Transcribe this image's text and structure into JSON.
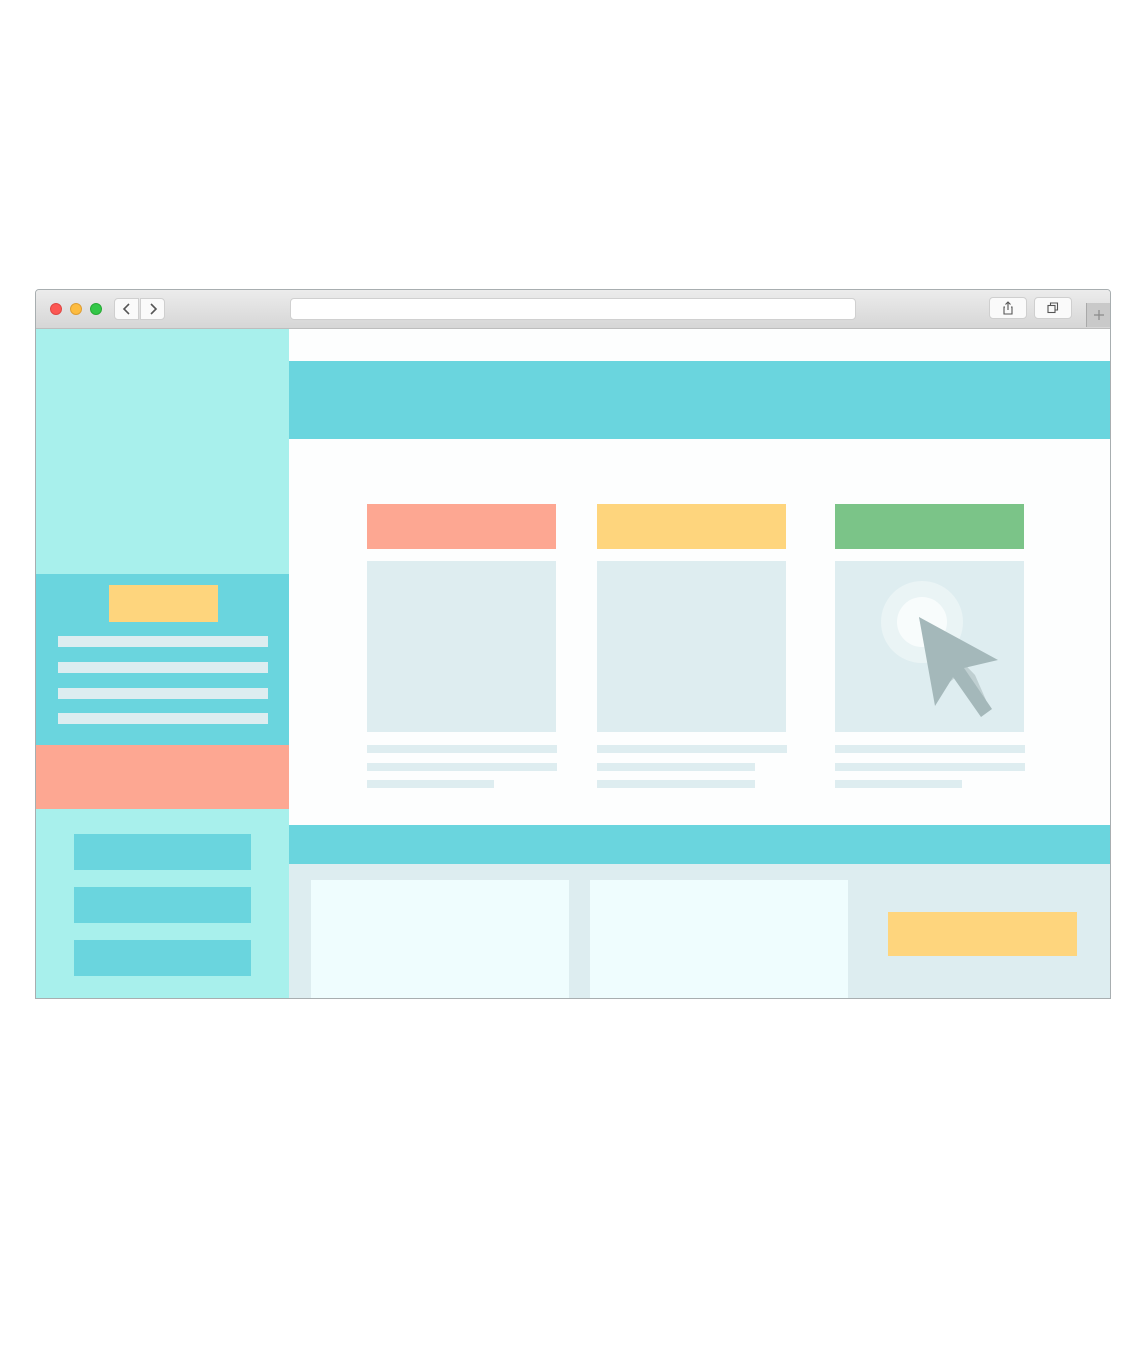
{
  "window": {
    "traffic_lights": [
      {
        "name": "close",
        "color": "#fc5753"
      },
      {
        "name": "minimize",
        "color": "#fdbc40"
      },
      {
        "name": "maximize",
        "color": "#33c748"
      }
    ],
    "nav_icons": {
      "back": "chevron-left-icon",
      "forward": "chevron-right-icon"
    },
    "address_bar": {
      "value": ""
    },
    "toolbar_icons": [
      "share-icon",
      "tabs-icon",
      "plus-icon"
    ]
  },
  "colors": {
    "sidebar_bg": "#a8f0ec",
    "accent_teal": "#6ad5de",
    "accent_yellow": "#fed57d",
    "accent_salmon": "#fda792",
    "accent_green": "#7bc488",
    "placeholder_gray": "#deedf0",
    "cursor": "#a4b8ba"
  },
  "cards": [
    {
      "header_color": "#fda792"
    },
    {
      "header_color": "#fed57d"
    },
    {
      "header_color": "#7bc488",
      "has_cursor": true
    }
  ]
}
